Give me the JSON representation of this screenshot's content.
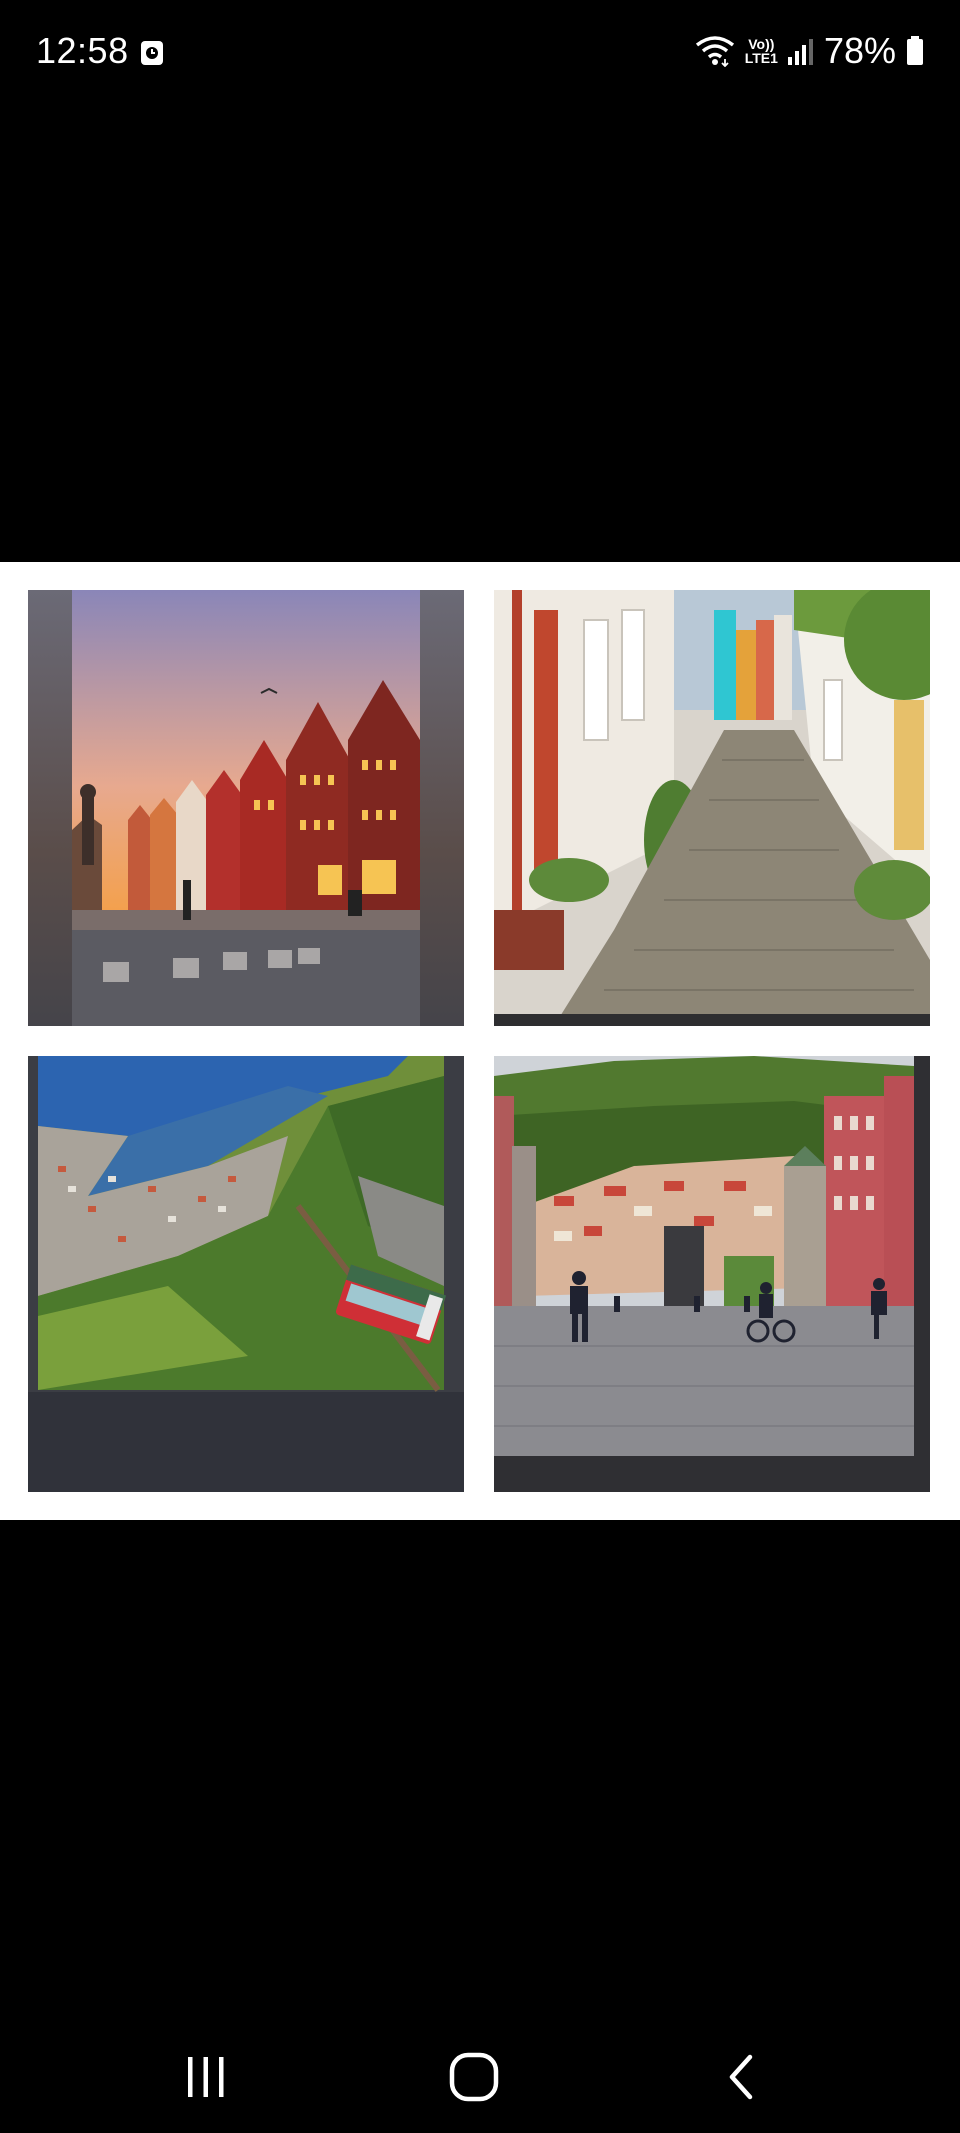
{
  "status_bar": {
    "time": "12:58",
    "network_label_top": "Vo))",
    "network_label_bottom": "LTE1",
    "battery_percent": "78%",
    "icons": [
      "alarm-notification-icon",
      "wifi-icon",
      "volte-icon",
      "signal-icon",
      "battery-icon"
    ]
  },
  "gallery": {
    "tiles": [
      {
        "subject": "colorful-wooden-waterfront-houses-at-sunset"
      },
      {
        "subject": "cobblestone-alley-with-white-houses"
      },
      {
        "subject": "funicular-over-city-and-harbor"
      },
      {
        "subject": "city-square-with-pedestrians-and-hills"
      }
    ]
  },
  "nav_bar": {
    "buttons": [
      "recents",
      "home",
      "back"
    ]
  },
  "colors": {
    "background": "#000000",
    "panel": "#ffffff",
    "status_text": "#ffffff"
  }
}
